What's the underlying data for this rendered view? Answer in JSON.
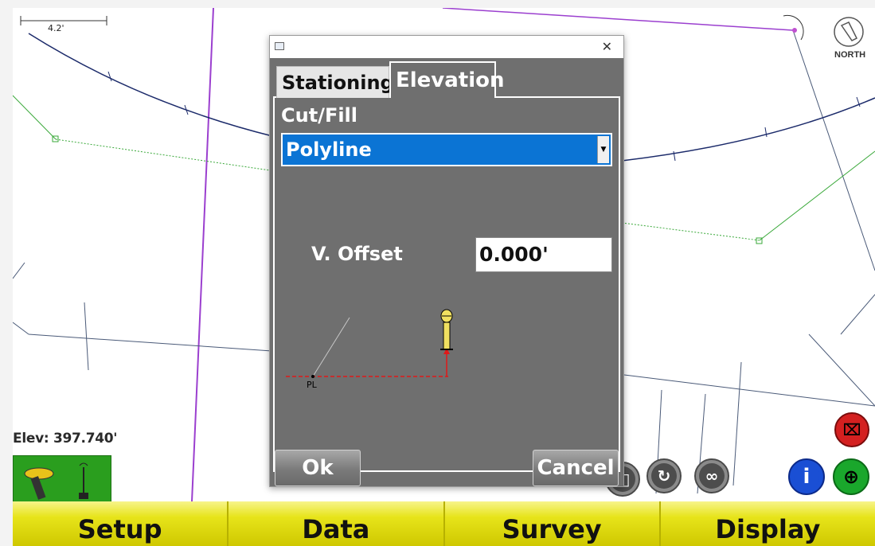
{
  "map": {
    "scale_label": "4.2'",
    "north_label": "NORTH",
    "elevation_readout": "Elev: 397.740'"
  },
  "dialog": {
    "tabs": [
      {
        "label": "Stationing",
        "active": false
      },
      {
        "label": "Elevation",
        "active": true
      }
    ],
    "section_label": "Cut/Fill",
    "dropdown_value": "Polyline",
    "v_offset_label": "V. Offset",
    "v_offset_value": "0.000'",
    "diagram_label": "PL",
    "ok_label": "Ok",
    "cancel_label": "Cancel"
  },
  "menubar": {
    "items": [
      "Setup",
      "Data",
      "Survey",
      "Display"
    ]
  },
  "colors": {
    "menu_yellow": "#e7e41a",
    "dialog_gray": "#6f6f6f",
    "select_blue": "#0b74d4",
    "status_green": "#2a9e1e"
  }
}
